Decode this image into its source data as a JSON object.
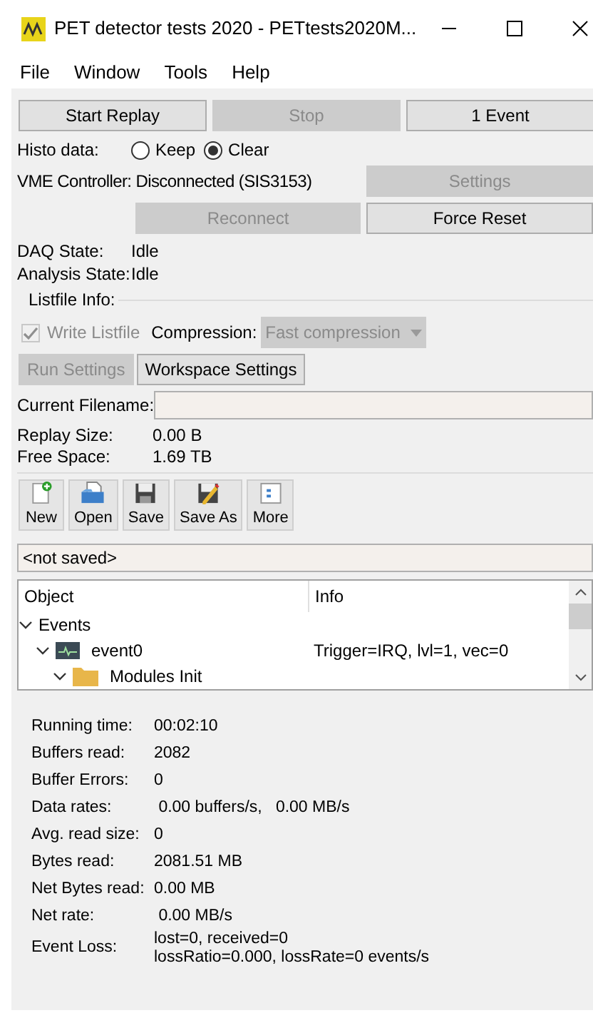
{
  "window": {
    "title": "PET detector tests 2020 - PETtests2020M..."
  },
  "menu": [
    "File",
    "Window",
    "Tools",
    "Help"
  ],
  "run_buttons": [
    {
      "label": "Start Replay",
      "disabled": false
    },
    {
      "label": "Stop",
      "disabled": true
    },
    {
      "label": "1 Event",
      "disabled": false
    }
  ],
  "histo": {
    "label": "Histo data:",
    "options": [
      {
        "label": "Keep",
        "selected": false
      },
      {
        "label": "Clear",
        "selected": true
      }
    ]
  },
  "vme": {
    "status": "VME Controller: Disconnected (SIS3153)",
    "settings": {
      "label": "Settings",
      "disabled": true
    },
    "reconnect": {
      "label": "Reconnect",
      "disabled": true
    },
    "force_reset": {
      "label": "Force Reset",
      "disabled": false
    }
  },
  "states": [
    {
      "label": "DAQ State:",
      "value": "Idle"
    },
    {
      "label": "Analysis State:",
      "value": "Idle"
    }
  ],
  "listfile": {
    "title": "Listfile Info:",
    "write_listfile": {
      "label": "Write Listfile",
      "checked": true,
      "disabled": true
    },
    "compression_label": "Compression:",
    "compression": {
      "value": "Fast compression",
      "disabled": true
    },
    "buttons": [
      {
        "label": "Run Settings",
        "disabled": true
      },
      {
        "label": "Workspace Settings",
        "disabled": false
      }
    ],
    "filename_label": "Current Filename:",
    "sizes": [
      {
        "label": "Replay Size:",
        "value": "0.00 B"
      },
      {
        "label": "Free Space:",
        "value": "1.69 TB"
      }
    ]
  },
  "toolbar": [
    {
      "kind": "new",
      "label": "New"
    },
    {
      "kind": "open",
      "label": "Open"
    },
    {
      "kind": "save",
      "label": "Save"
    },
    {
      "kind": "saveas",
      "label": "Save As"
    },
    {
      "kind": "more",
      "label": "More"
    }
  ],
  "workspace_path": "<not saved>",
  "tree": {
    "columns": [
      "Object",
      "Info"
    ],
    "items": [
      {
        "label": "Events",
        "expanded": true,
        "children": [
          {
            "kind": "event",
            "label": "event0",
            "info": "Trigger=IRQ, lvl=1, vec=0",
            "expanded": true,
            "children": [
              {
                "kind": "folder",
                "label": "Modules Init",
                "expanded": true
              }
            ]
          }
        ]
      }
    ]
  },
  "stats": [
    {
      "label": "Running time:",
      "value": "00:02:10"
    },
    {
      "label": "Buffers read:",
      "value": "2082"
    },
    {
      "label": "Buffer Errors:",
      "value": "0"
    },
    {
      "label": "Data rates:",
      "value": " 0.00 buffers/s,   0.00 MB/s"
    },
    {
      "label": "Avg. read size:",
      "value": "0"
    },
    {
      "label": "Bytes read:",
      "value": "2081.51 MB"
    },
    {
      "label": "Net Bytes read:",
      "value": "0.00 MB"
    },
    {
      "label": "Net rate:",
      "value": " 0.00 MB/s"
    },
    {
      "label": "Event Loss:",
      "value": "lost=0, received=0",
      "value_2": "lossRatio=0.000, lossRate=0 events/s"
    }
  ]
}
